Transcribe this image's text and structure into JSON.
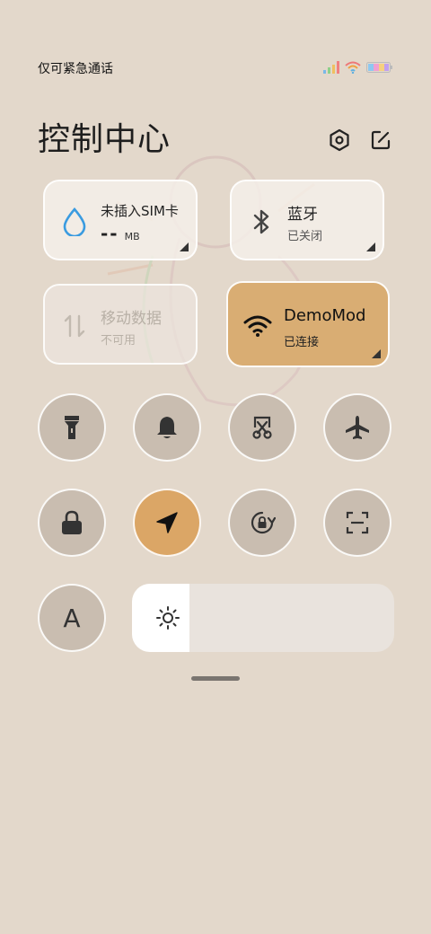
{
  "status": {
    "text": "仅可紧急通话"
  },
  "header": {
    "title": "控制中心"
  },
  "tiles": {
    "data_usage": {
      "title": "未插入SIM卡",
      "value": "--",
      "unit": "MB"
    },
    "bluetooth": {
      "title": "蓝牙",
      "status": "已关闭"
    },
    "mobile_data": {
      "title": "移动数据",
      "status": "不可用"
    },
    "wifi": {
      "title": "DemoMod",
      "status": "已连接"
    }
  },
  "toggles": {
    "row1": [
      "flashlight-icon",
      "bell-icon",
      "screenshot-icon",
      "airplane-icon"
    ],
    "row2": [
      "lock-icon",
      "location-icon",
      "rotation-lock-icon",
      "scanner-icon"
    ],
    "font_size_letter": "A"
  },
  "brightness": {
    "level": 0.22
  },
  "colors": {
    "accent": "#dba666",
    "wifi_tile": "#d9ad73",
    "background": "#e3d8cb"
  }
}
